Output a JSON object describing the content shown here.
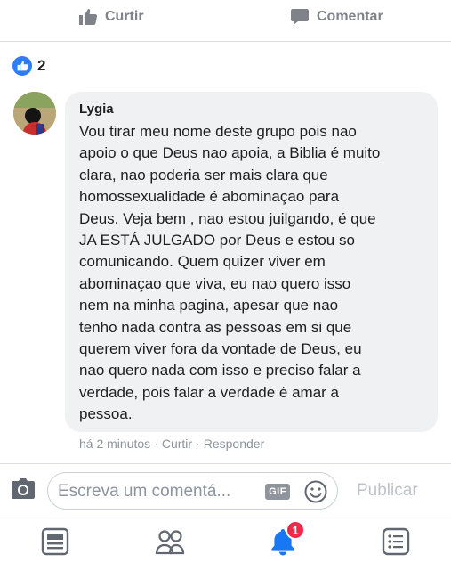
{
  "actions": {
    "like_label": "Curtir",
    "comment_label": "Comentar",
    "like_icon": "thumbs-up-icon",
    "comment_icon": "comment-bubble-icon"
  },
  "reactions": {
    "count": "2",
    "icon": "like-badge-icon",
    "color": "#2e7cf6"
  },
  "comment": {
    "author": "Lygia",
    "text": "Vou tirar meu nome deste grupo pois nao\napoio o que Deus nao apoia, a Biblia é muito\nclara, nao poderia ser mais clara que\nhomossexualidade é abominaçao para\nDeus. Veja bem , nao estou juilgando, é que\nJA ESTÁ JULGADO  por Deus e estou so\ncomunicando. Quem quizer viver em\nabominaçao que viva, eu nao quero isso\nnem na minha pagina, apesar que nao\ntenho nada contra as pessoas em si que\nquerem viver fora da vontade de Deus, eu\nnao quero nada com isso  e preciso falar a\nverdade, pois falar a verdade é amar  a\npessoa.",
    "timestamp": "há 2 minutos",
    "separator": "·",
    "like_action": "Curtir",
    "reply_action": "Responder"
  },
  "composer": {
    "placeholder": "Escreva um comentá...",
    "gif_label": "GIF",
    "publish_label": "Publicar",
    "camera_icon": "camera-icon",
    "emoji_icon": "smiley-icon"
  },
  "bottom_nav": {
    "items": [
      {
        "icon": "news-feed-icon"
      },
      {
        "icon": "groups-icon"
      },
      {
        "icon": "bell-icon",
        "badge": "1",
        "active_color": "#1877f2",
        "badge_color": "#f02849"
      },
      {
        "icon": "menu-icon"
      }
    ]
  }
}
